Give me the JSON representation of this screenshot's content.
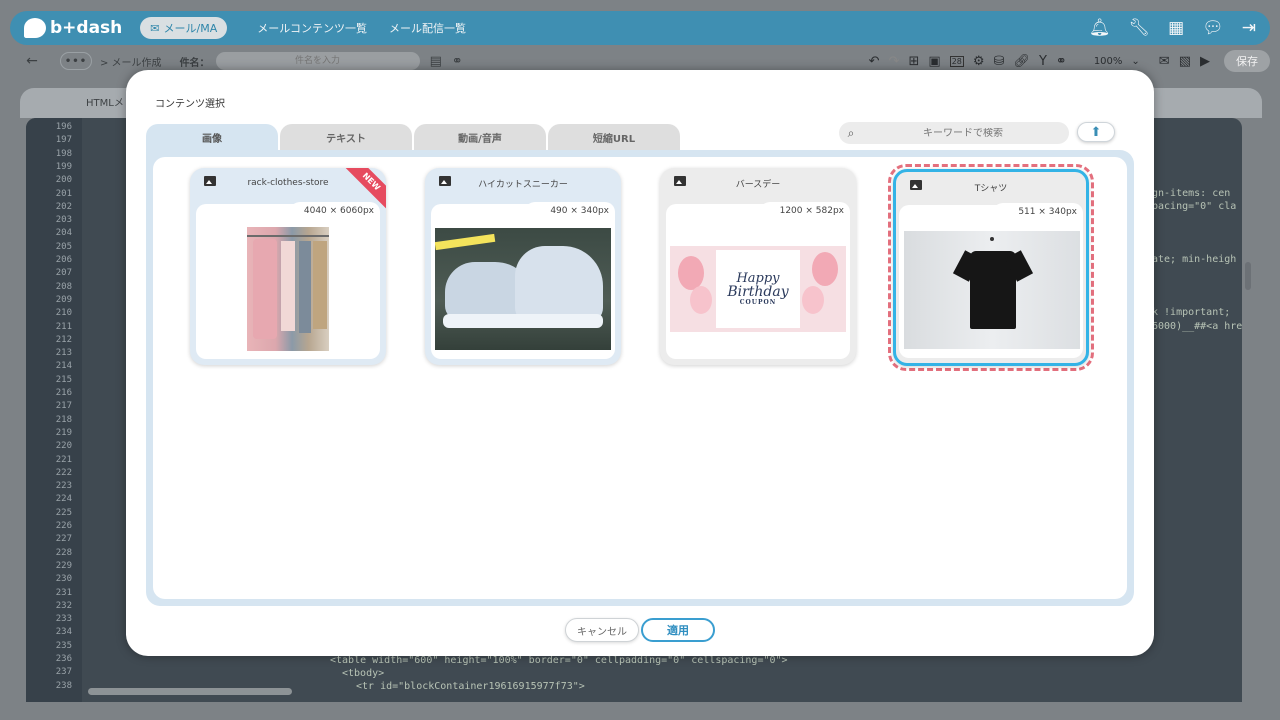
{
  "app": {
    "logo": "b+dash",
    "module": "メール/MA"
  },
  "nav": [
    "メールコンテンツ一覧",
    "メール配信一覧"
  ],
  "toolbar": {
    "more": "•••",
    "breadcrumb": "> メール作成",
    "subject_label": "件名：",
    "subject_placeholder": "件名を入力",
    "zoom": "100%",
    "save": "保存",
    "date_icon": "28"
  },
  "editor": {
    "tab": "HTMLメ",
    "line_numbers": [
      "196",
      "197",
      "198",
      "199",
      "200",
      "201",
      "202",
      "203",
      "204",
      "205",
      "206",
      "207",
      "208",
      "209",
      "210",
      "211",
      "212",
      "213",
      "214",
      "215",
      "216",
      "217",
      "218",
      "219",
      "220",
      "221",
      "222",
      "223",
      "224",
      "225",
      "226",
      "227",
      "228",
      "229",
      "230",
      "231",
      "232",
      "233",
      "234",
      "235",
      "236",
      "237",
      "238"
    ],
    "snippets": [
      "gn-items: cen",
      "pacing=\"0\" cla",
      "ate; min-heigh",
      "k !important;",
      "6000)__##<a hre",
      "<table width=\"600\" height=\"100%\" border=\"0\" cellpadding=\"0\" cellspacing=\"0\">",
      "<tbody>",
      "<tr id=\"blockContainer19616915977f73\">"
    ]
  },
  "modal": {
    "title": "コンテンツ選択",
    "tabs": [
      "画像",
      "テキスト",
      "動画/音声",
      "短縮URL"
    ],
    "active_tab": "画像",
    "search_placeholder": "キーワードで検索",
    "cancel": "キャンセル",
    "apply": "適用"
  },
  "cards": [
    {
      "name": "rack-clothes-store",
      "dims": "4040 × 6060px",
      "badge": "NEW"
    },
    {
      "name": "ハイカットスニーカー",
      "dims": "490 × 340px"
    },
    {
      "name": "バースデー",
      "dims": "1200 × 582px",
      "art_text_1": "Happy",
      "art_text_2": "Birthday",
      "art_text_3": "COUPON"
    },
    {
      "name": "Tシャツ",
      "dims": "511 × 340px",
      "selected": true
    }
  ]
}
